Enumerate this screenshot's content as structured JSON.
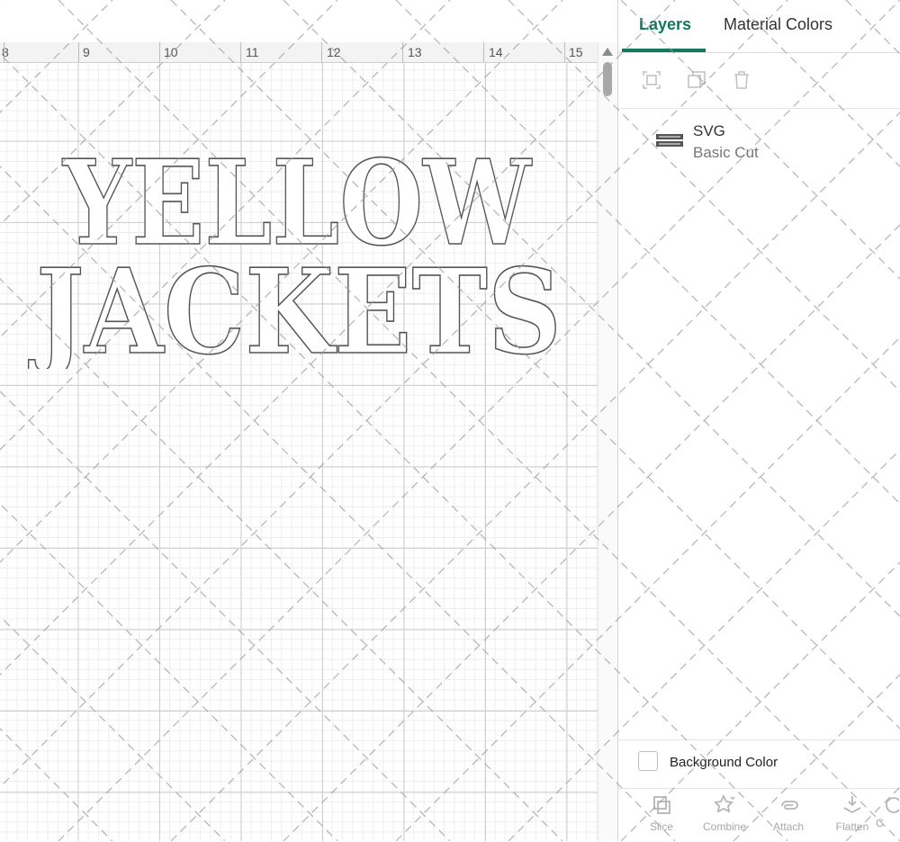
{
  "ruler": {
    "marks": [
      "8",
      "9",
      "10",
      "11",
      "12",
      "13",
      "14",
      "15"
    ]
  },
  "design": {
    "line1": "YELLOW",
    "line2": "JACKETS"
  },
  "panel": {
    "tabs": [
      {
        "label": "Layers",
        "active": true
      },
      {
        "label": "Material Colors",
        "active": false
      }
    ],
    "layer_toolbar": [
      "group-icon",
      "duplicate-icon",
      "delete-icon"
    ],
    "layer": {
      "name": "SVG",
      "operation": "Basic Cut"
    },
    "background_color": {
      "label": "Background Color",
      "checked": false
    },
    "bottom_toolbar": [
      {
        "label": "Slice",
        "icon": "slice-icon"
      },
      {
        "label": "Combine",
        "icon": "combine-icon"
      },
      {
        "label": "Attach",
        "icon": "attach-icon"
      },
      {
        "label": "Flatten",
        "icon": "flatten-icon"
      },
      {
        "label": "C",
        "icon": "contour-icon"
      }
    ]
  },
  "colors": {
    "accent": "#13795b",
    "outline": "#555555"
  }
}
